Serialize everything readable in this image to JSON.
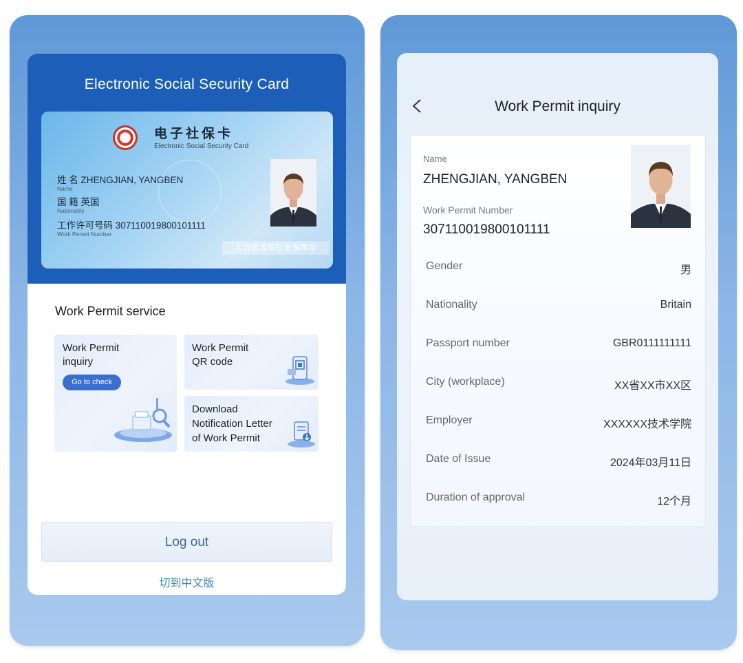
{
  "left": {
    "header_title": "Electronic Social Security Card",
    "card": {
      "title_cn": "电子社保卡",
      "title_en": "Electronic Social Security Card",
      "name_label_cn": "姓 名",
      "name_value": "ZHENGJIAN, YANGBEN",
      "name_label_en": "Name",
      "nationality_label_cn": "国 籍",
      "nationality_value": "英国",
      "nationality_label_en": "Nationality",
      "permit_label_cn": "工作许可号码",
      "permit_value": "307110019800101111",
      "permit_label_en": "Work Permit Number",
      "footer_text": "人力资源和社会保障部"
    },
    "service_title": "Work Permit service",
    "tiles": {
      "inquiry": {
        "line1": "Work Permit",
        "line2": "inquiry",
        "button": "Go to check"
      },
      "qr": {
        "line1": "Work Permit",
        "line2": "QR code"
      },
      "download": {
        "line1": "Download",
        "line2": "Notification Letter",
        "line3": "of Work Permit"
      }
    },
    "logout_label": "Log out",
    "switch_lang": "切到中文版"
  },
  "right": {
    "title": "Work Permit inquiry",
    "name_label": "Name",
    "name_value": "ZHENGJIAN, YANGBEN",
    "permit_label": "Work Permit Number",
    "permit_value": "307110019800101111",
    "rows": [
      {
        "label": "Gender",
        "value": "男"
      },
      {
        "label": "Nationality",
        "value": "Britain"
      },
      {
        "label": "Passport number",
        "value": "GBR0111111111"
      },
      {
        "label": "City (workplace)",
        "value": "XX省XX市XX区"
      },
      {
        "label": "Employer",
        "value": "XXXXXX技术学院"
      },
      {
        "label": "Date of Issue",
        "value": "2024年03月11日"
      },
      {
        "label": "Duration of approval",
        "value": "12个月"
      }
    ]
  },
  "colors": {
    "phone_frame": "#6fa3dd",
    "header_blue": "#1d5fb8",
    "button_blue": "#3a6fcf",
    "link_teal": "#3d89b8"
  },
  "icons": [
    "back-chevron-icon",
    "social-security-emblem-icon",
    "qr-phone-icon",
    "document-download-icon",
    "magnifier-inquiry-icon"
  ]
}
